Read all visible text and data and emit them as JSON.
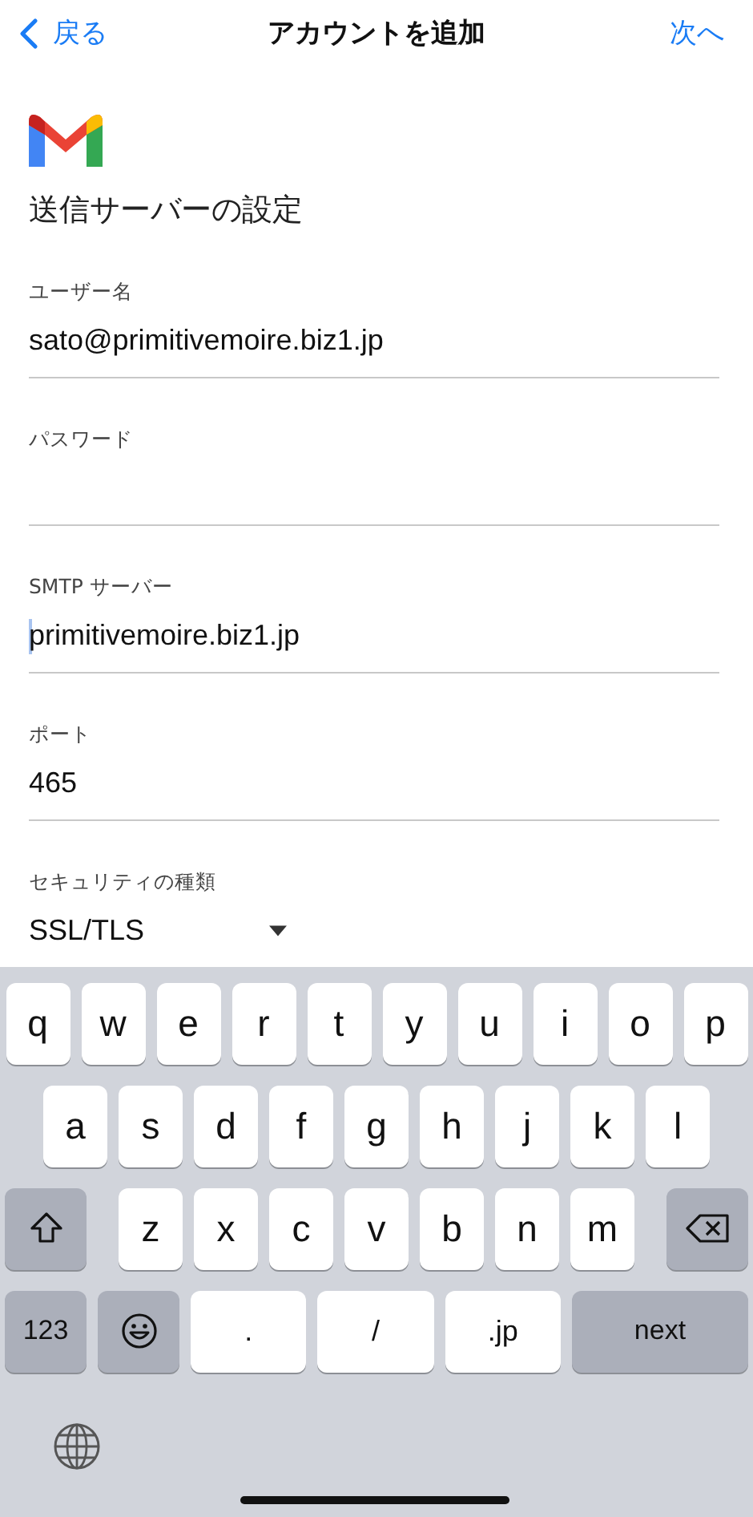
{
  "nav": {
    "back": "戻る",
    "title": "アカウントを追加",
    "next": "次へ"
  },
  "heading": "送信サーバーの設定",
  "fields": [
    {
      "kind": "text",
      "label": "ユーザー名",
      "value": "sato@primitivemoire.biz1.jp",
      "focused": false
    },
    {
      "kind": "password",
      "label": "パスワード",
      "focused": false
    },
    {
      "kind": "text",
      "label": "SMTP サーバー",
      "value": "primitivemoire.biz1.jp",
      "focused": true
    },
    {
      "kind": "text",
      "label": "ポート",
      "value": "465",
      "focused": false
    },
    {
      "kind": "select",
      "label": "セキュリティの種類",
      "value": "SSL/TLS"
    }
  ],
  "keyboard": {
    "letter_rows": [
      {
        "keys": [
          {
            "kind": "letter",
            "label": "q"
          },
          {
            "kind": "letter",
            "label": "w"
          },
          {
            "kind": "letter",
            "label": "e"
          },
          {
            "kind": "letter",
            "label": "r"
          },
          {
            "kind": "letter",
            "label": "t"
          },
          {
            "kind": "letter",
            "label": "y"
          },
          {
            "kind": "letter",
            "label": "u"
          },
          {
            "kind": "letter",
            "label": "i"
          },
          {
            "kind": "letter",
            "label": "o"
          },
          {
            "kind": "letter",
            "label": "p"
          }
        ]
      },
      {
        "keys": [
          {
            "kind": "letter",
            "label": "a"
          },
          {
            "kind": "letter",
            "label": "s"
          },
          {
            "kind": "letter",
            "label": "d"
          },
          {
            "kind": "letter",
            "label": "f"
          },
          {
            "kind": "letter",
            "label": "g"
          },
          {
            "kind": "letter",
            "label": "h"
          },
          {
            "kind": "letter",
            "label": "j"
          },
          {
            "kind": "letter",
            "label": "k"
          },
          {
            "kind": "letter",
            "label": "l"
          }
        ]
      },
      {
        "keys": [
          {
            "kind": "shift"
          },
          {
            "kind": "letter",
            "label": "z"
          },
          {
            "kind": "letter",
            "label": "x"
          },
          {
            "kind": "letter",
            "label": "c"
          },
          {
            "kind": "letter",
            "label": "v"
          },
          {
            "kind": "letter",
            "label": "b"
          },
          {
            "kind": "letter",
            "label": "n"
          },
          {
            "kind": "letter",
            "label": "m"
          },
          {
            "kind": "delete"
          }
        ]
      }
    ],
    "bottom_row": [
      {
        "kind": "mode",
        "label": "123"
      },
      {
        "kind": "emoji"
      },
      {
        "kind": "symbol",
        "label": "."
      },
      {
        "kind": "symbol",
        "label": "/"
      },
      {
        "kind": "symbol",
        "label": ".jp"
      },
      {
        "kind": "return",
        "label": "next"
      }
    ]
  }
}
